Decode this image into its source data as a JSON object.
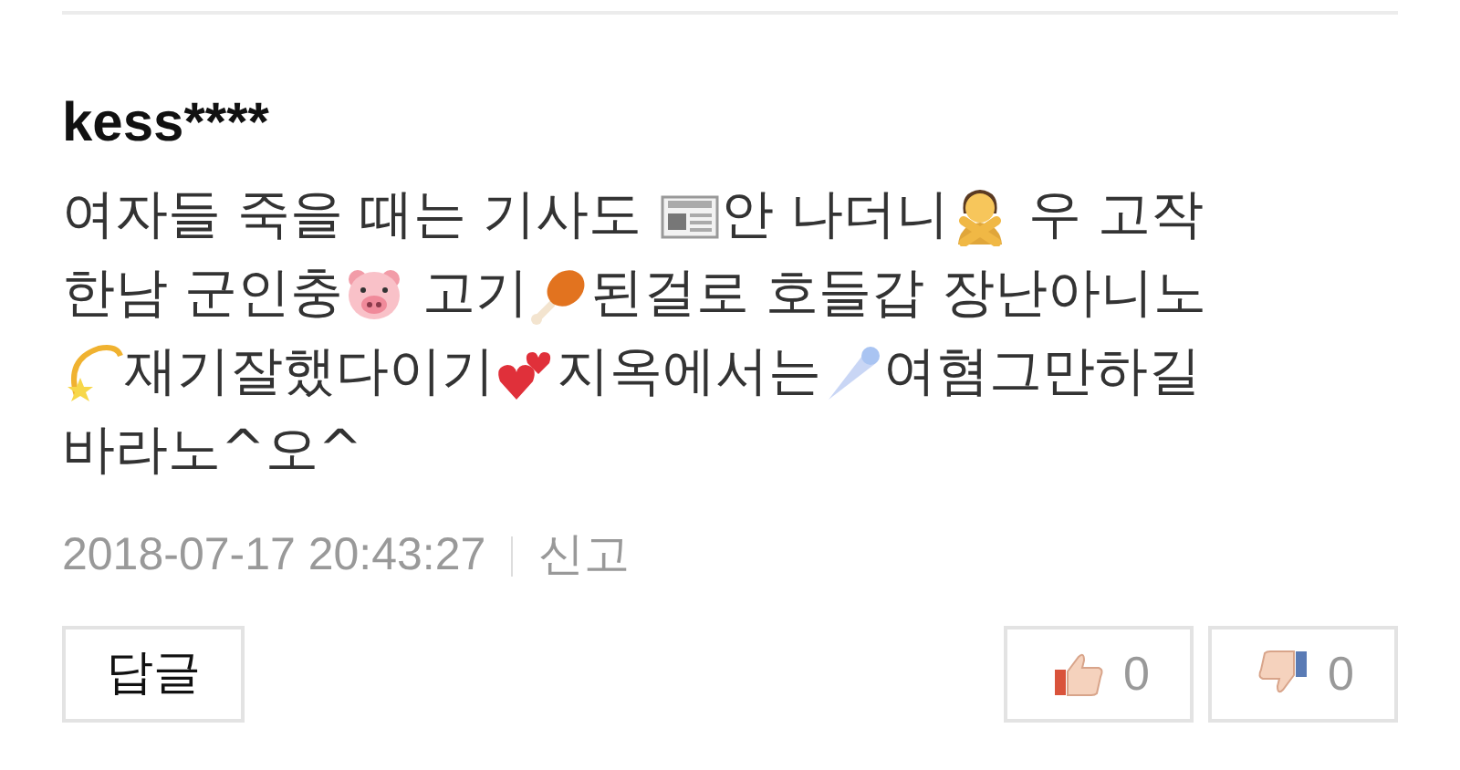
{
  "username": "kess****",
  "body_lines": [
    [
      {
        "kind": "text",
        "text": "여자들 죽을 때는 기사도 "
      },
      {
        "kind": "icon"
      },
      {
        "kind": "text",
        "text": "안 나더니"
      },
      {
        "kind": "icon"
      },
      {
        "kind": "text",
        "text": " 우 고작"
      }
    ],
    [
      {
        "kind": "text",
        "text": "한남 군인충"
      },
      {
        "kind": "icon"
      },
      {
        "kind": "text",
        "text": " 고기"
      },
      {
        "kind": "icon"
      },
      {
        "kind": "text",
        "text": "된걸로 호들갑 장난아니노"
      }
    ],
    [
      {
        "kind": "icon"
      },
      {
        "kind": "text",
        "text": "재기잘했다이기"
      },
      {
        "kind": "icon"
      },
      {
        "kind": "text",
        "text": "지옥에서는"
      },
      {
        "kind": "icon"
      },
      {
        "kind": "text",
        "text": "여혐그만하길"
      }
    ],
    [
      {
        "kind": "text",
        "text": "바라노^오^"
      }
    ]
  ],
  "timestamp": "2018-07-17 20:43:27",
  "report_link": "신고",
  "reply_button": "답글",
  "votes": [
    {
      "kind": "up",
      "count": "0"
    },
    {
      "kind": "down",
      "count": "0"
    }
  ]
}
